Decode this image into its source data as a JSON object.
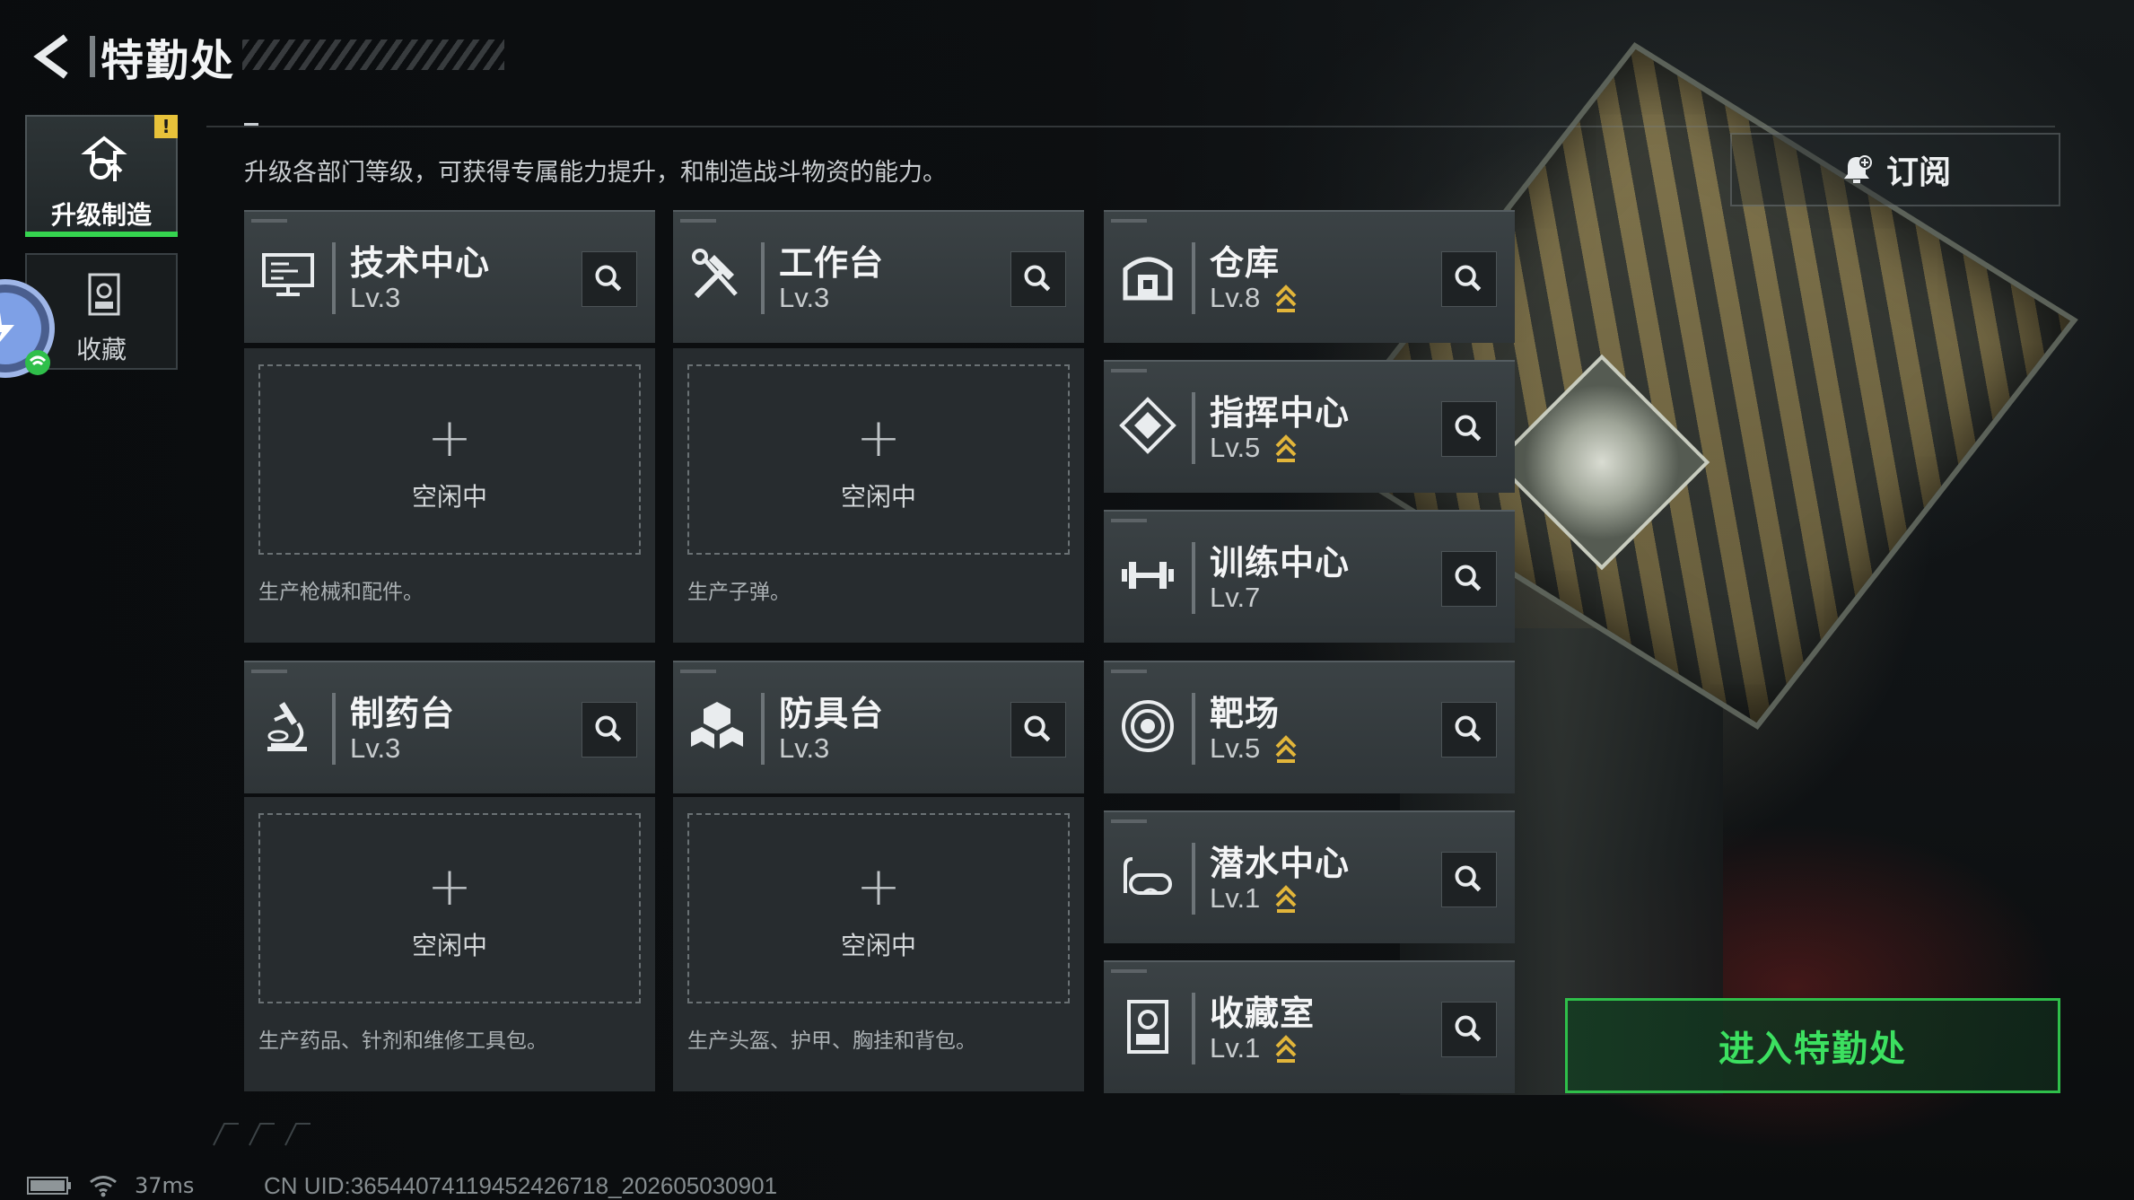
{
  "header": {
    "title": "特勤处",
    "description": "升级各部门等级，可获得专属能力提升，和制造战斗物资的能力。",
    "subscribe_label": "订阅",
    "warning_badge": "!"
  },
  "nav": {
    "upgrade_label": "升级制造",
    "collection_label": "收藏"
  },
  "departments": [
    {
      "name": "技术中心",
      "level": "Lv.3",
      "icon": "computer-icon",
      "upgradable": false
    },
    {
      "name": "工作台",
      "level": "Lv.3",
      "icon": "tools-icon",
      "upgradable": false
    },
    {
      "name": "仓库",
      "level": "Lv.8",
      "icon": "warehouse-icon",
      "upgradable": true
    },
    {
      "name": "指挥中心",
      "level": "Lv.5",
      "icon": "command-icon",
      "upgradable": true
    },
    {
      "name": "训练中心",
      "level": "Lv.7",
      "icon": "dumbbell-icon",
      "upgradable": false
    },
    {
      "name": "制药台",
      "level": "Lv.3",
      "icon": "microscope-icon",
      "upgradable": false
    },
    {
      "name": "防具台",
      "level": "Lv.3",
      "icon": "armor-icon",
      "upgradable": false
    },
    {
      "name": "靶场",
      "level": "Lv.5",
      "icon": "target-icon",
      "upgradable": true
    },
    {
      "name": "潜水中心",
      "level": "Lv.1",
      "icon": "dive-mask-icon",
      "upgradable": true
    },
    {
      "name": "收藏室",
      "level": "Lv.1",
      "icon": "collection-icon",
      "upgradable": true
    }
  ],
  "slots": [
    {
      "status": "空闲中",
      "desc": "生产枪械和配件。"
    },
    {
      "status": "空闲中",
      "desc": "生产子弹。"
    },
    {
      "status": "空闲中",
      "desc": "生产药品、针剂和维修工具包。"
    },
    {
      "status": "空闲中",
      "desc": "生产头盔、护甲、胸挂和背包。"
    }
  ],
  "enter_button": "进入特勤处",
  "status_bar": {
    "ping": "37ms",
    "uid": "CN UID:36544074119452426718_202605030901"
  },
  "colors": {
    "accent_green": "#35d44f",
    "upgrade_arrow": "#e2b53a",
    "warning": "#e8c23a"
  }
}
